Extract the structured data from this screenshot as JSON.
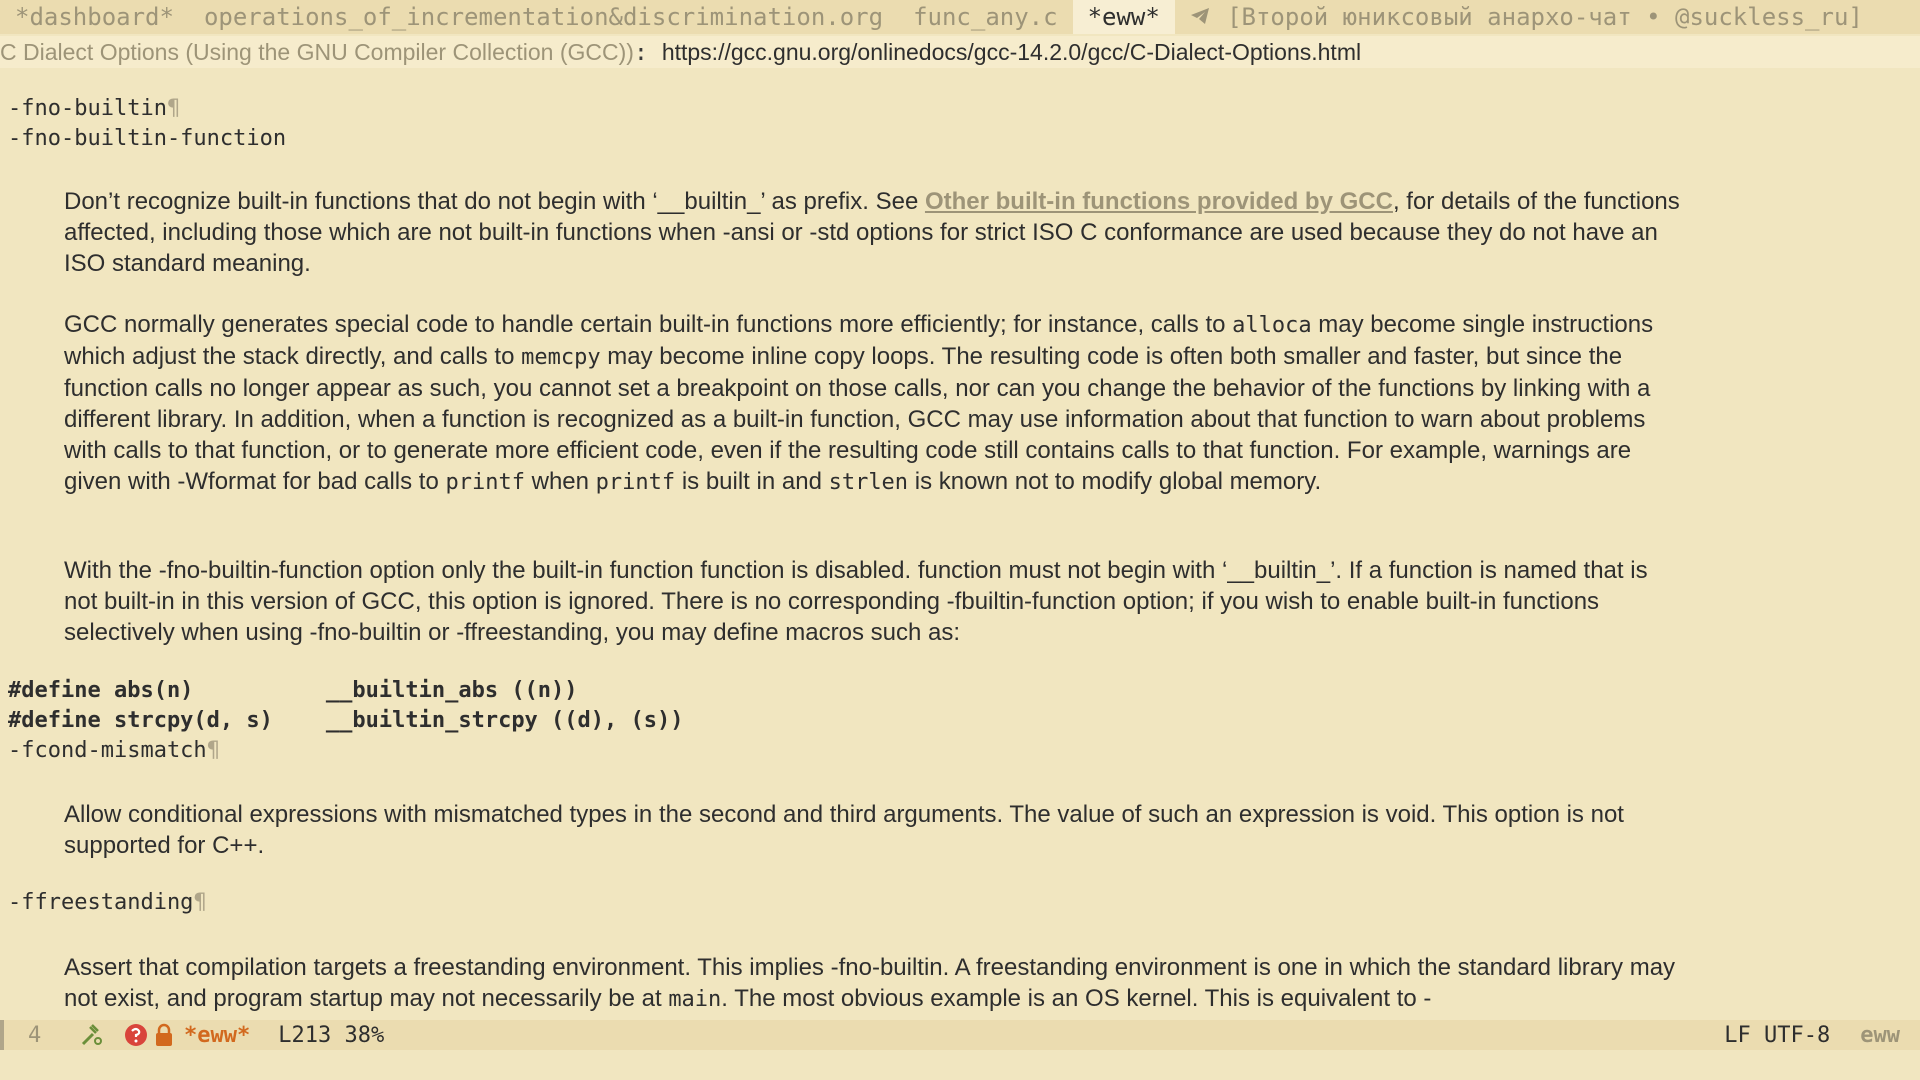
{
  "tabs": [
    {
      "label": "*dashboard*"
    },
    {
      "label": "operations_of_incrementation&discrimination.org"
    },
    {
      "label": "func_any.c"
    },
    {
      "label": "*eww*"
    },
    {
      "label": "[Второй юниксовый анархо-чат • @suckless_ru]"
    }
  ],
  "header": {
    "title": "C Dialect Options (Using the GNU Compiler Collection (GCC))",
    "separator": ":",
    "url": "https://gcc.gnu.org/onlinedocs/gcc-14.2.0/gcc/C-Dialect-Options.html"
  },
  "content": {
    "opt1": "-fno-builtin",
    "opt2": "-fno-builtin-function",
    "p1_a": "Don’t recognize built-in functions that do not begin with ‘__builtin_’ as prefix. See ",
    "p1_link": "Other built-in functions provided by GCC",
    "p1_b": ", for details of the functions affected, including those which are not built-in functions when -ansi or -std options for strict ISO C conformance are used because they do not have an ISO standard meaning.",
    "p2_a": "GCC normally generates special code to handle certain built-in functions more efficiently; for instance, calls to ",
    "p2_code1": "alloca",
    "p2_b": " may become single instructions which adjust the stack directly, and calls to ",
    "p2_code2": "memcpy",
    "p2_c": " may become inline copy loops. The resulting code is often both smaller and faster, but since the function calls no longer appear as such, you cannot set a breakpoint on those calls, nor can you change the behavior of the functions by linking with a different library. In addition, when a function is recognized as a built-in function, GCC may use information about that function to warn about problems with calls to that function, or to generate more efficient code, even if the resulting code still contains calls to that function. For example, warnings are given with -Wformat for bad calls to ",
    "p2_code3": "printf",
    "p2_d": " when ",
    "p2_code4": "printf",
    "p2_e": " is built in and ",
    "p2_code5": "strlen",
    "p2_f": " is known not to modify global memory.",
    "p3": "With the -fno-builtin-function option only the built-in function function is disabled. function must not begin with ‘__builtin_’. If a function is named that is not built-in in this version of GCC, this option is ignored. There is no corresponding -fbuiltin-function option; if you wish to enable built-in functions selectively when using -fno-builtin or -ffreestanding, you may define macros such as:",
    "code1": "#define abs(n)          __builtin_abs ((n))",
    "code2": "#define strcpy(d, s)    __builtin_strcpy ((d), (s))",
    "opt3": "-fcond-mismatch",
    "p4": "Allow conditional expressions with mismatched types in the second and third arguments. The value of such an expression is void. This option is not supported for C++.",
    "opt4": "-ffreestanding",
    "p5_a": "Assert that compilation targets a freestanding environment. This implies -fno-builtin. A freestanding environment is one in which the standard library may not exist, and program startup may not necessarily be at ",
    "p5_code": "main",
    "p5_b": ". The most obvious example is an OS kernel. This is equivalent to -",
    "pilcrow": "¶"
  },
  "modeline": {
    "window_number": "4",
    "buffer_name": "*eww*",
    "position": "L213 38%",
    "encoding": "LF UTF-8",
    "major_mode": "eww"
  },
  "icons": {
    "tab_telegram": "send-icon",
    "modeline_1": "tools-icon",
    "modeline_2": "error-icon",
    "modeline_3": "lock-icon"
  },
  "colors": {
    "background": "#f1e6c0",
    "link": "#9d9478",
    "buffer_name": "#d2691e",
    "error": "#d9443b"
  }
}
